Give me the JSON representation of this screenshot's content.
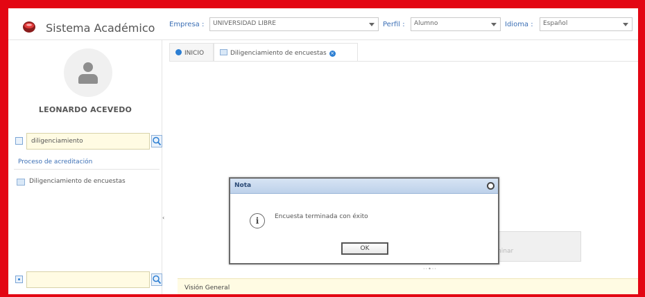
{
  "header": {
    "app_title": "Sistema Académico",
    "company_label": "Empresa :",
    "company_value": "UNIVERSIDAD LIBRE",
    "profile_label": "Perfil :",
    "profile_value": "Alumno",
    "language_label": "Idioma :",
    "language_value": "Español"
  },
  "sidebar": {
    "user_name": "LEONARDO ACEVEDO",
    "search_value": "diligenciamiento",
    "process_link": "Proceso de acreditación",
    "items": [
      {
        "label": "Diligenciamiento de encuestas"
      }
    ]
  },
  "tabs": [
    {
      "label": "INICIO"
    },
    {
      "label": "Diligenciamiento de encuestas"
    }
  ],
  "background": {
    "panel_text": "minar"
  },
  "overview": {
    "title": "Visión General"
  },
  "dialog": {
    "title": "Nota",
    "message": "Encuesta terminada con éxito",
    "ok_label": "OK"
  },
  "colors": {
    "frame": "#e30613",
    "accent_blue": "#2d7fd3",
    "search_bg": "#fffbe3"
  }
}
